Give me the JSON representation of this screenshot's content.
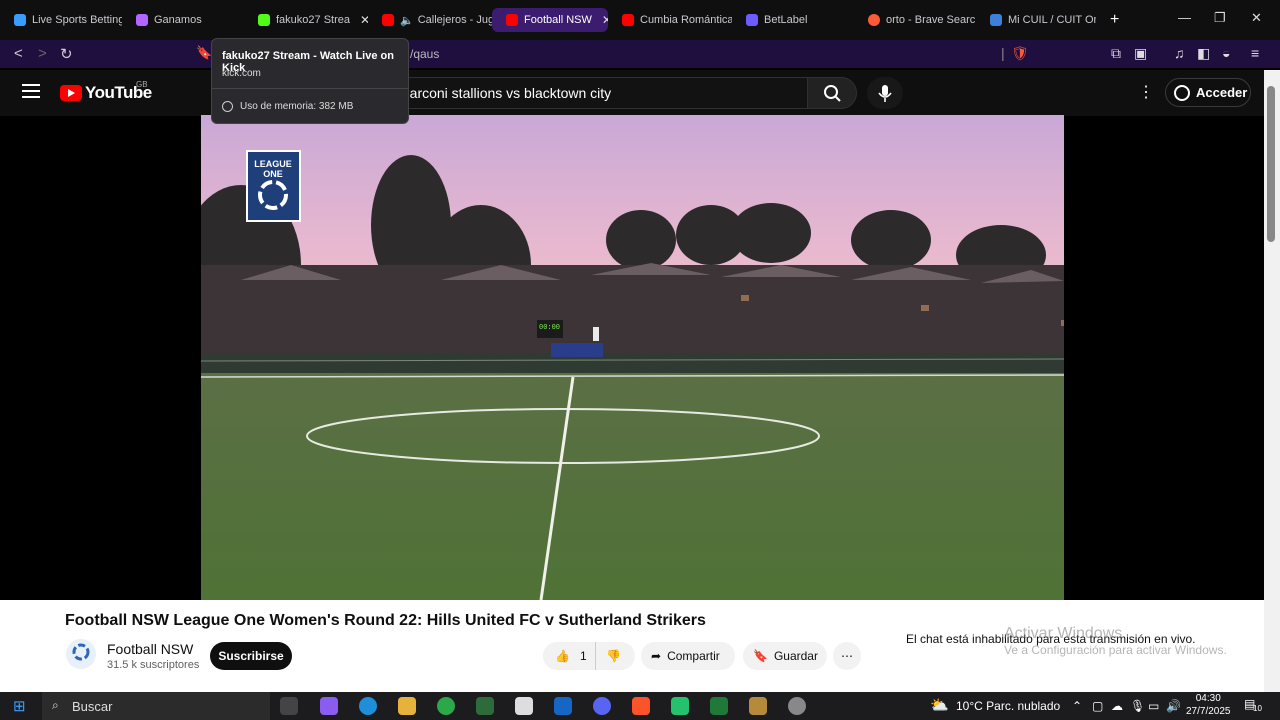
{
  "browser": {
    "tabs": [
      {
        "label": "Live Sports Betting",
        "color": "#3b9cff"
      },
      {
        "label": "Ganamos",
        "color": "#b565ff"
      },
      {
        "label": "fakuko27 Strea",
        "color": "#53fc18"
      },
      {
        "label": "Callejeros - Jug",
        "color": "#ff0000"
      },
      {
        "label": "Football NSW",
        "color": "#ff0000"
      },
      {
        "label": "Cumbia Romántica",
        "color": "#ff0000"
      },
      {
        "label": "BetLabel",
        "color": "#6a5cff"
      },
      {
        "label": "orto - Brave Search",
        "color": "#ff5a36"
      },
      {
        "label": "Mi CUIL / CUIT Onl",
        "color": "#3d7fd9"
      }
    ],
    "new_tab": "+",
    "url_fragment": "/qaus"
  },
  "tooltip": {
    "title": "fakuko27 Stream - Watch Live on Kick",
    "host": "kick.com",
    "memory": "Uso de memoria: 382 MB"
  },
  "youtube": {
    "logo_text": "YouTube",
    "country": "GB",
    "search_query": "marconi stallions vs blacktown city",
    "sign_in": "Acceder",
    "video_title": "Football NSW League One Women's Round 22: Hills United FC v Sutherland Strikers",
    "channel_name": "Football NSW",
    "subscribers": "31.5 k suscriptores",
    "subscribe": "Suscribirse",
    "likes": "1",
    "share": "Compartir",
    "save": "Guardar",
    "chat_disabled": "El chat está inhabilitado para esta transmisión en vivo.",
    "badge_line1": "LEAGUE",
    "badge_line2": "ONE",
    "scoreboard": "00:00"
  },
  "windows": {
    "activate_title": "Activar Windows",
    "activate_sub": "Ve a Configuración para activar Windows.",
    "search_placeholder": "Buscar",
    "weather": "10°C  Parc. nublado",
    "time": "04:30",
    "date": "27/7/2025",
    "notifications": "10"
  }
}
